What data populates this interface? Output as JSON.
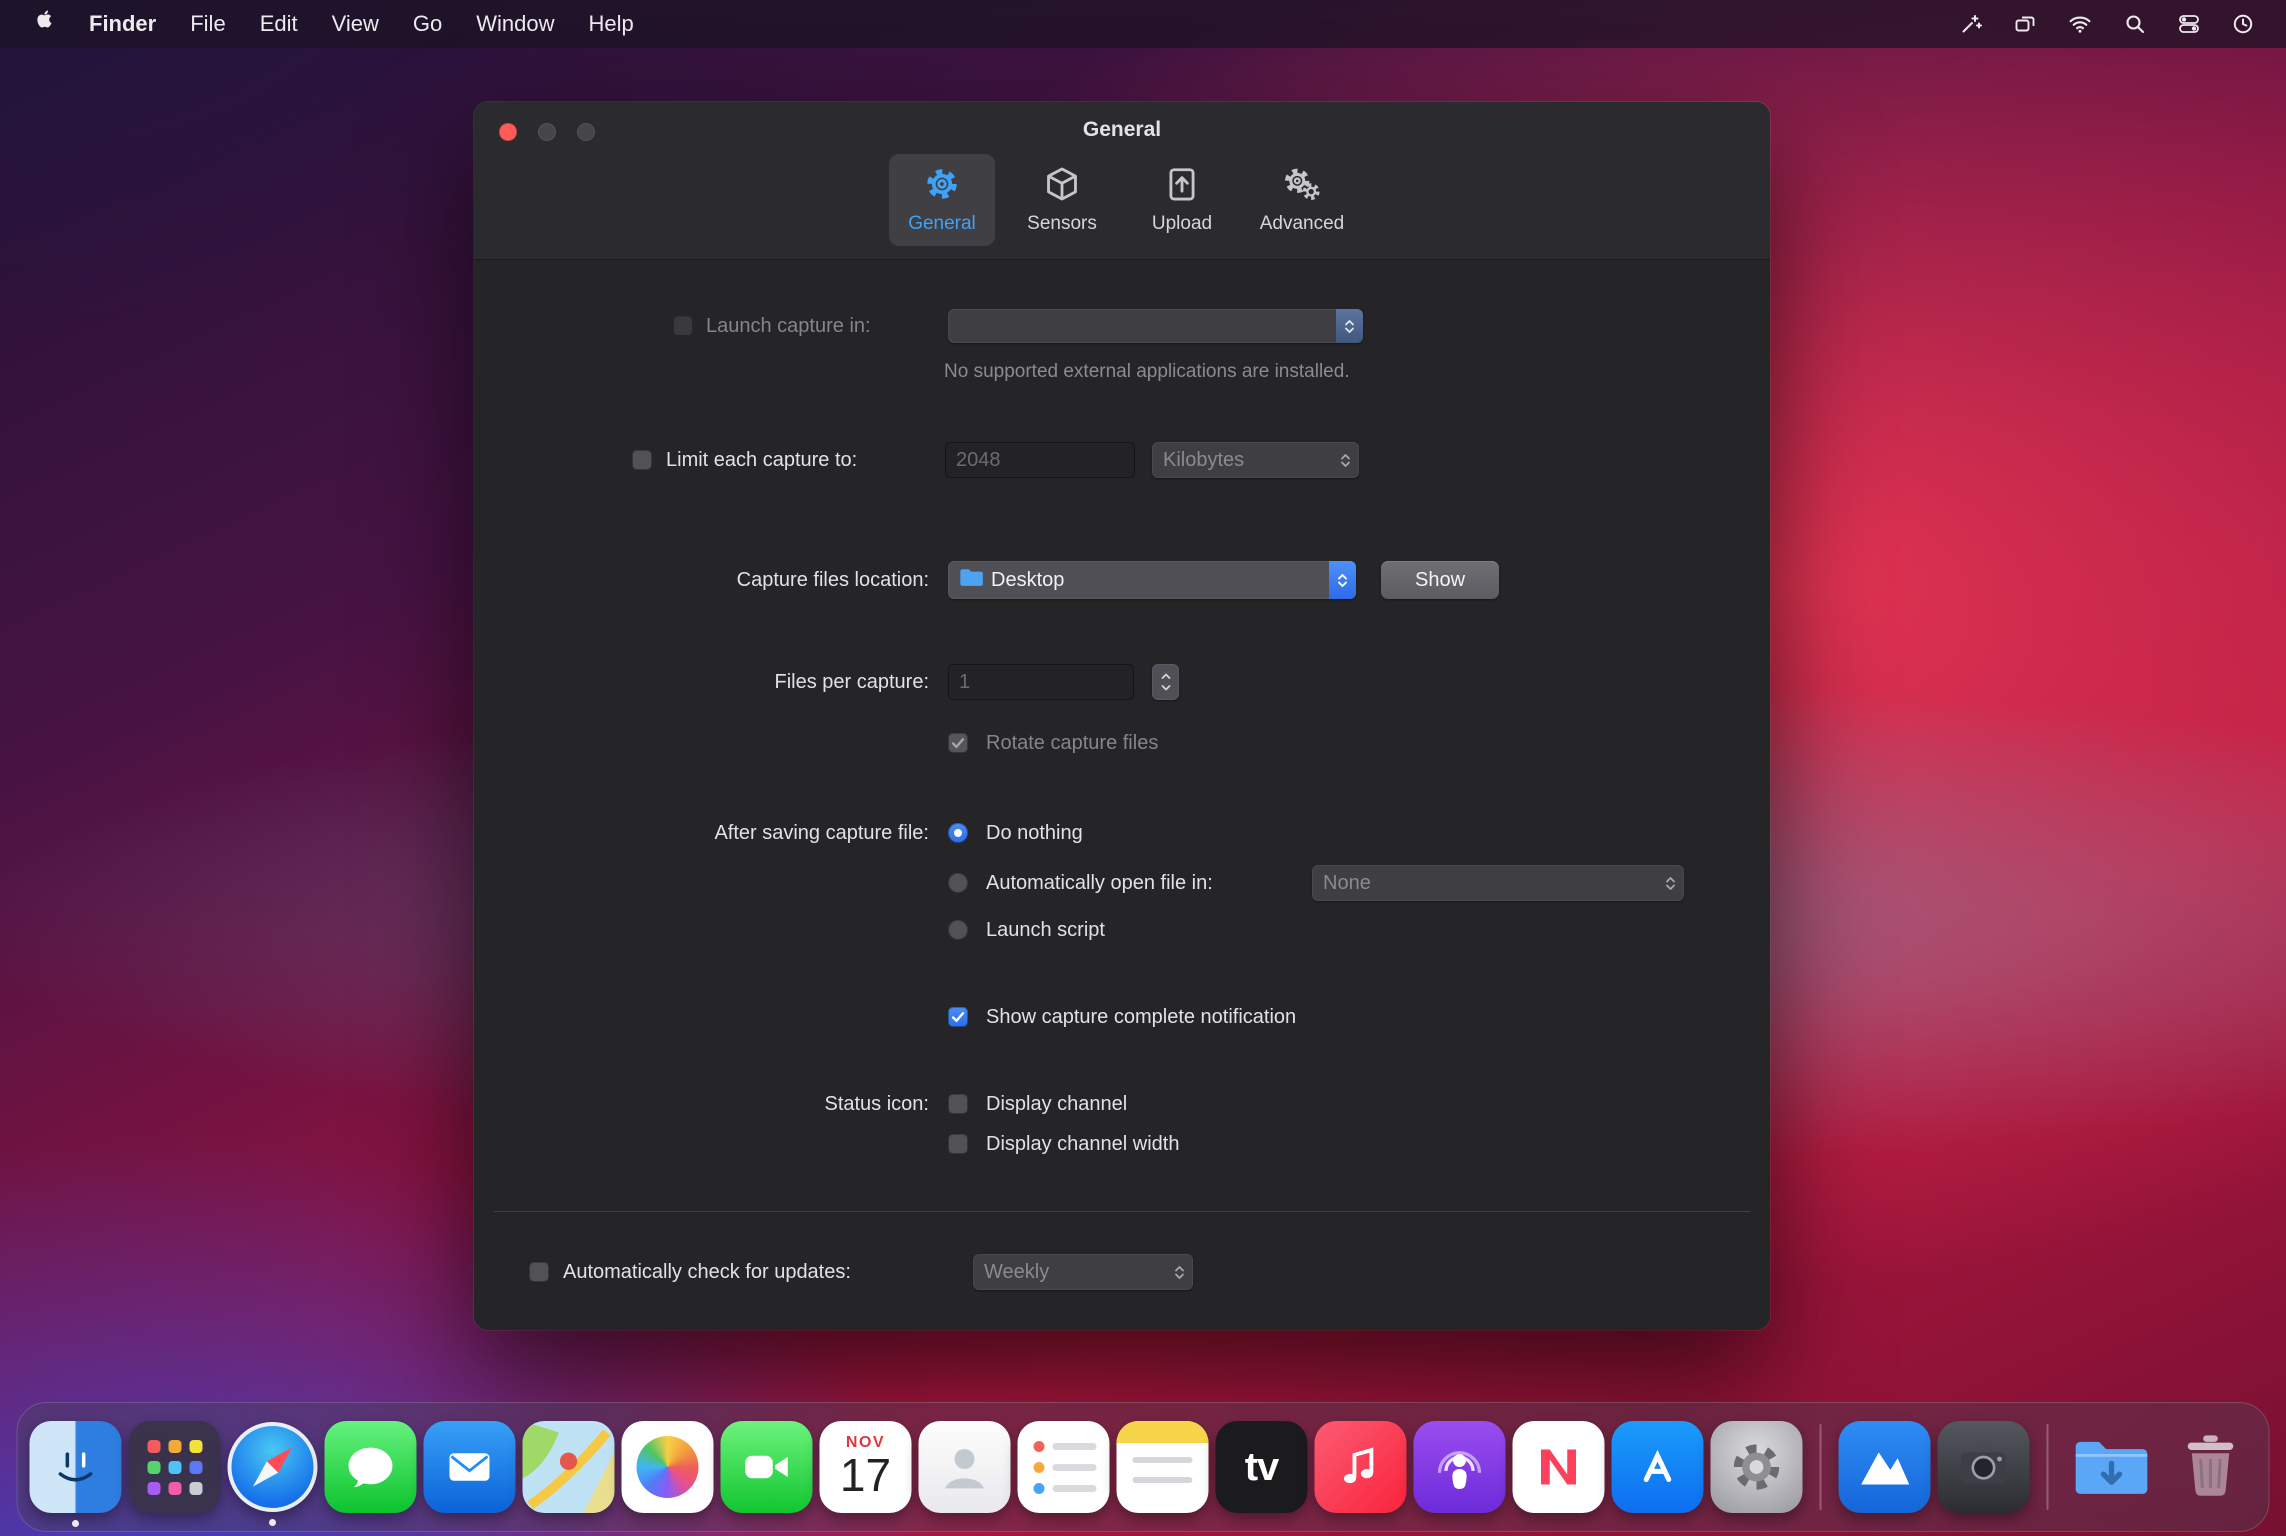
{
  "colors": {
    "accent": "#2f7cf6",
    "selected_tab": "#3ea2f8",
    "window_bg": "#2b2a2e"
  },
  "menu_bar": {
    "app_name": "Finder",
    "menus": [
      "File",
      "Edit",
      "View",
      "Go",
      "Window",
      "Help"
    ],
    "status_icons": [
      "screen-record-icon",
      "displays-icon",
      "wifi-icon",
      "spotlight-icon",
      "control-center-icon",
      "clock-icon"
    ]
  },
  "window": {
    "title": "General",
    "tabs": [
      {
        "label": "General",
        "selected": true,
        "icon": "gear-icon"
      },
      {
        "label": "Sensors",
        "selected": false,
        "icon": "cube-icon"
      },
      {
        "label": "Upload",
        "selected": false,
        "icon": "upload-document-icon"
      },
      {
        "label": "Advanced",
        "selected": false,
        "icon": "gears-icon"
      }
    ],
    "launch_capture": {
      "label": "Launch capture in:",
      "checked": false,
      "note": "No supported external applications are installed."
    },
    "limit": {
      "label": "Limit each capture to:",
      "checked": false,
      "value": "2048",
      "unit": "Kilobytes"
    },
    "location": {
      "label": "Capture files location:",
      "value": "Desktop",
      "icon": "folder-icon",
      "show": "Show"
    },
    "files_per_capture": {
      "label": "Files per capture:",
      "value": "1"
    },
    "rotate": {
      "label": "Rotate capture files",
      "checked": true
    },
    "after_saving": {
      "label": "After saving capture file:",
      "do_nothing": "Do nothing",
      "open_in": "Automatically open file in:",
      "open_in_value": "None",
      "launch_script": "Launch script",
      "selected": "Do nothing"
    },
    "notify": {
      "label": "Show capture complete notification",
      "checked": true
    },
    "status_icon": {
      "label": "Status icon:",
      "channel": "Display channel",
      "channel_width": "Display channel width"
    },
    "updates": {
      "label": "Automatically check for updates:",
      "checked": false,
      "value": "Weekly"
    }
  },
  "dock": {
    "items": [
      "finder",
      "launchpad",
      "safari",
      "messages",
      "mail",
      "maps",
      "photos",
      "facetime",
      "calendar",
      "contacts",
      "reminders",
      "notes",
      "tv",
      "music",
      "podcasts",
      "news",
      "app-store",
      "system-preferences",
      "wifi-explorer",
      "capture-app",
      "downloads",
      "trash"
    ],
    "running": [
      "finder",
      "safari"
    ],
    "calendar": {
      "month": "NOV",
      "day": "17"
    },
    "tv_label": "tv"
  }
}
